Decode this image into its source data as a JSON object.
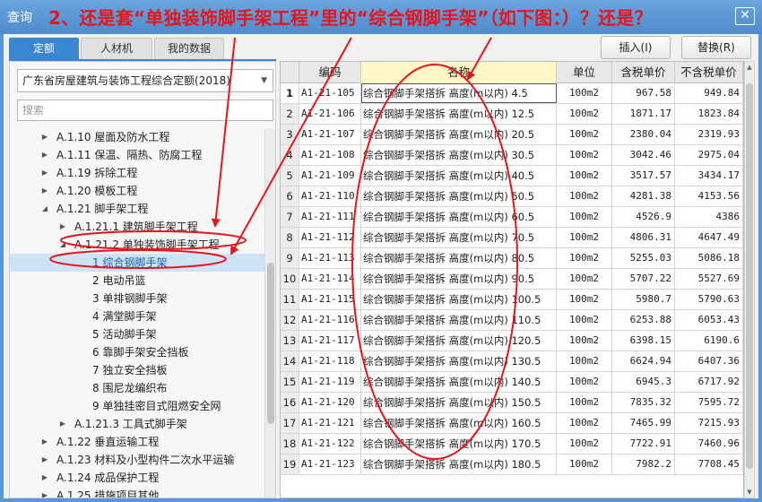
{
  "window": {
    "title": "查询",
    "close_icon": "✕"
  },
  "annotation": "2、还是套“单独装饰脚手架工程”里的“综合钢脚手架”（如下图：）？还是？",
  "tabs": [
    {
      "label": "定额",
      "active": true
    },
    {
      "label": "人材机",
      "active": false
    },
    {
      "label": "我的数据",
      "active": false
    }
  ],
  "toolbar": {
    "insert_label": "插入(I)",
    "replace_label": "替换(R)"
  },
  "quota_select": {
    "value": "广东省房屋建筑与装饰工程综合定额(2018)"
  },
  "search": {
    "placeholder": "搜索"
  },
  "tree": [
    {
      "level": 0,
      "toggle": "collapsed",
      "label": "A.1.10 屋面及防水工程"
    },
    {
      "level": 0,
      "toggle": "collapsed",
      "label": "A.1.11 保温、隔热、防腐工程"
    },
    {
      "level": 0,
      "toggle": "collapsed",
      "label": "A.1.19 拆除工程"
    },
    {
      "level": 0,
      "toggle": "collapsed",
      "label": "A.1.20 模板工程"
    },
    {
      "level": 0,
      "toggle": "expanded",
      "label": "A.1.21 脚手架工程"
    },
    {
      "level": 1,
      "toggle": "collapsed",
      "label": "A.1.21.1 建筑脚手架工程"
    },
    {
      "level": 1,
      "toggle": "expanded",
      "label": "A.1.21.2 单独装饰脚手架工程"
    },
    {
      "level": 2,
      "toggle": "none",
      "label": "1 综合钢脚手架",
      "selected": true
    },
    {
      "level": 2,
      "toggle": "none",
      "label": "2 电动吊篮"
    },
    {
      "level": 2,
      "toggle": "none",
      "label": "3 单排钢脚手架"
    },
    {
      "level": 2,
      "toggle": "none",
      "label": "4 满堂脚手架"
    },
    {
      "level": 2,
      "toggle": "none",
      "label": "5 活动脚手架"
    },
    {
      "level": 2,
      "toggle": "none",
      "label": "6 靠脚手架安全挡板"
    },
    {
      "level": 2,
      "toggle": "none",
      "label": "7 独立安全挡板"
    },
    {
      "level": 2,
      "toggle": "none",
      "label": "8 围尼龙编织布"
    },
    {
      "level": 2,
      "toggle": "none",
      "label": "9 单独挂密目式阻燃安全网"
    },
    {
      "level": 1,
      "toggle": "collapsed",
      "label": "A.1.21.3 工具式脚手架"
    },
    {
      "level": 0,
      "toggle": "collapsed",
      "label": "A.1.22 垂直运输工程"
    },
    {
      "level": 0,
      "toggle": "collapsed",
      "label": "A.1.23 材料及小型构件二次水平运输"
    },
    {
      "level": 0,
      "toggle": "collapsed",
      "label": "A.1.24 成品保护工程"
    },
    {
      "level": 0,
      "toggle": "collapsed",
      "label": "A.1.25 措施项目其他"
    }
  ],
  "grid": {
    "headers": [
      "",
      "编码",
      "名称",
      "单位",
      "含税单价",
      "不含税单价"
    ],
    "rows": [
      [
        "1",
        "A1-21-105",
        "综合钢脚手架搭拆 高度(m以内) 4.5",
        "100m2",
        "967.58",
        "949.84"
      ],
      [
        "2",
        "A1-21-106",
        "综合钢脚手架搭拆 高度(m以内) 12.5",
        "100m2",
        "1871.17",
        "1823.84"
      ],
      [
        "3",
        "A1-21-107",
        "综合钢脚手架搭拆 高度(m以内) 20.5",
        "100m2",
        "2380.04",
        "2319.93"
      ],
      [
        "4",
        "A1-21-108",
        "综合钢脚手架搭拆 高度(m以内) 30.5",
        "100m2",
        "3042.46",
        "2975.04"
      ],
      [
        "5",
        "A1-21-109",
        "综合钢脚手架搭拆 高度(m以内) 40.5",
        "100m2",
        "3517.57",
        "3434.17"
      ],
      [
        "6",
        "A1-21-110",
        "综合钢脚手架搭拆 高度(m以内) 50.5",
        "100m2",
        "4281.38",
        "4153.56"
      ],
      [
        "7",
        "A1-21-111",
        "综合钢脚手架搭拆 高度(m以内) 60.5",
        "100m2",
        "4526.9",
        "4386"
      ],
      [
        "8",
        "A1-21-112",
        "综合钢脚手架搭拆 高度(m以内) 70.5",
        "100m2",
        "4806.31",
        "4647.49"
      ],
      [
        "9",
        "A1-21-113",
        "综合钢脚手架搭拆 高度(m以内) 80.5",
        "100m2",
        "5255.03",
        "5086.18"
      ],
      [
        "10",
        "A1-21-114",
        "综合钢脚手架搭拆 高度(m以内) 90.5",
        "100m2",
        "5707.22",
        "5527.69"
      ],
      [
        "11",
        "A1-21-115",
        "综合钢脚手架搭拆 高度(m以内) 100.5",
        "100m2",
        "5980.7",
        "5790.63"
      ],
      [
        "12",
        "A1-21-116",
        "综合钢脚手架搭拆 高度(m以内) 110.5",
        "100m2",
        "6253.88",
        "6053.43"
      ],
      [
        "13",
        "A1-21-117",
        "综合钢脚手架搭拆 高度(m以内) 120.5",
        "100m2",
        "6398.15",
        "6190.6"
      ],
      [
        "14",
        "A1-21-118",
        "综合钢脚手架搭拆 高度(m以内) 130.5",
        "100m2",
        "6624.94",
        "6407.36"
      ],
      [
        "15",
        "A1-21-119",
        "综合钢脚手架搭拆 高度(m以内) 140.5",
        "100m2",
        "6945.3",
        "6717.92"
      ],
      [
        "16",
        "A1-21-120",
        "综合钢脚手架搭拆 高度(m以内) 150.5",
        "100m2",
        "7835.32",
        "7595.72"
      ],
      [
        "17",
        "A1-21-121",
        "综合钢脚手架搭拆 高度(m以内) 160.5",
        "100m2",
        "7465.99",
        "7215.93"
      ],
      [
        "18",
        "A1-21-122",
        "综合钢脚手架搭拆 高度(m以内) 170.5",
        "100m2",
        "7722.91",
        "7460.96"
      ],
      [
        "19",
        "A1-21-123",
        "综合钢脚手架搭拆 高度(m以内) 180.5",
        "100m2",
        "7982.2",
        "7708.45"
      ]
    ]
  },
  "colors": {
    "annotation_red": "#e8141b",
    "accent_blue": "#3a86d3",
    "header_highlight": "#fff7c8"
  }
}
